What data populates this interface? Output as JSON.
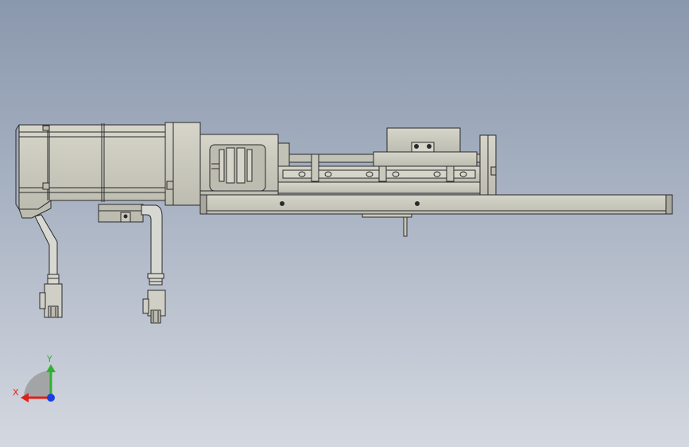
{
  "colors": {
    "body_fill": "#c9c8bd",
    "body_dark": "#a9a89c",
    "outline": "#2a2a2a",
    "cable_fill": "#d8d8d2",
    "axis_x": "#e0201a",
    "axis_y": "#2fb12f",
    "axis_z": "#1a3fe0"
  },
  "triad": {
    "x_label": "X",
    "y_label": "Y"
  }
}
